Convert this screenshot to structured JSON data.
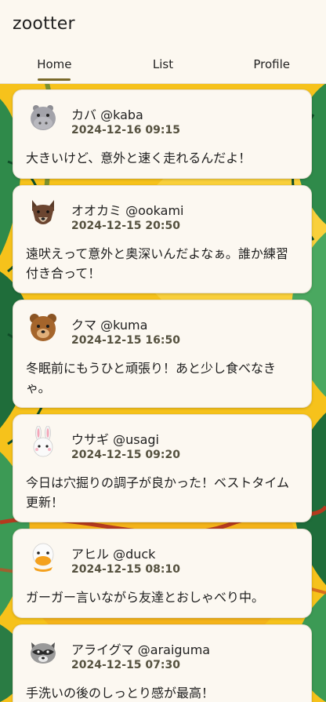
{
  "app": {
    "title": "zootter"
  },
  "tabs": [
    {
      "label": "Home",
      "active": true
    },
    {
      "label": "List",
      "active": false
    },
    {
      "label": "Profile",
      "active": false
    }
  ],
  "posts": [
    {
      "name": "カバ @kaba",
      "time": "2024-12-16 09:15",
      "text": "大きいけど、意外と速く走れるんだよ！",
      "avatar": "hippo-icon"
    },
    {
      "name": "オオカミ @ookami",
      "time": "2024-12-15 20:50",
      "text": "遠吠えって意外と奥深いんだよなぁ。誰か練習付き合って！",
      "avatar": "wolf-icon"
    },
    {
      "name": "クマ @kuma",
      "time": "2024-12-15 16:50",
      "text": "冬眠前にもうひと頑張り！あと少し食べなきゃ。",
      "avatar": "bear-icon"
    },
    {
      "name": "ウサギ @usagi",
      "time": "2024-12-15 09:20",
      "text": "今日は穴掘りの調子が良かった！ベストタイム更新！",
      "avatar": "rabbit-icon"
    },
    {
      "name": "アヒル @duck",
      "time": "2024-12-15 08:10",
      "text": "ガーガー言いながら友達とおしゃべり中。",
      "avatar": "duck-icon"
    },
    {
      "name": "アライグマ @araiguma",
      "time": "2024-12-15 07:30",
      "text": "手洗いの後のしっとり感が最高！",
      "avatar": "raccoon-icon"
    }
  ],
  "colors": {
    "background_yellow": "#f7c51a",
    "leaf_green": "#2f8a4a",
    "card_bg": "#fcf8f1",
    "tab_indicator": "#7a6a2a"
  }
}
